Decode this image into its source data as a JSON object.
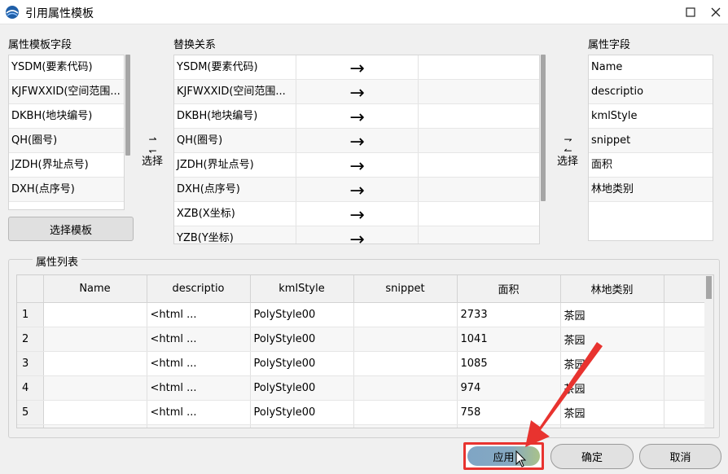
{
  "window": {
    "title": "引用属性模板",
    "maximize_icon": "maximize-icon",
    "close_icon": "close-icon"
  },
  "left_panel": {
    "label": "属性模板字段",
    "items": [
      "YSDM(要素代码)",
      "KJFWXXID(空间范围...",
      "DKBH(地块编号)",
      "QH(圈号)",
      "JZDH(界址点号)",
      "DXH(点序号)"
    ],
    "select_label": "选择",
    "template_button": "选择模板"
  },
  "mapping": {
    "label": "替换关系",
    "arrow": "→",
    "rows": [
      "YSDM(要素代码)",
      "KJFWXXID(空间范围...",
      "DKBH(地块编号)",
      "QH(圈号)",
      "JZDH(界址点号)",
      "DXH(点序号)",
      "XZB(X坐标)",
      "YZB(Y坐标)"
    ]
  },
  "right_panel": {
    "label": "属性字段",
    "items": [
      "Name",
      "descriptio",
      "kmlStyle",
      "snippet",
      "面积",
      "林地类别"
    ],
    "select_label": "选择"
  },
  "attribute_list": {
    "title": "属性列表",
    "columns": [
      "Name",
      "descriptio",
      "kmlStyle",
      "snippet",
      "面积",
      "林地类别"
    ],
    "rows": [
      {
        "num": "1",
        "name": "",
        "descriptio": "<html ...",
        "kmlStyle": "PolyStyle00",
        "snippet": "",
        "area": "2733",
        "type": "茶园"
      },
      {
        "num": "2",
        "name": "",
        "descriptio": "<html ...",
        "kmlStyle": "PolyStyle00",
        "snippet": "",
        "area": "1041",
        "type": "茶园"
      },
      {
        "num": "3",
        "name": "",
        "descriptio": "<html ...",
        "kmlStyle": "PolyStyle00",
        "snippet": "",
        "area": "1085",
        "type": "茶园"
      },
      {
        "num": "4",
        "name": "",
        "descriptio": "<html ...",
        "kmlStyle": "PolyStyle00",
        "snippet": "",
        "area": "974",
        "type": "茶园"
      },
      {
        "num": "5",
        "name": "",
        "descriptio": "<html ...",
        "kmlStyle": "PolyStyle00",
        "snippet": "",
        "area": "758",
        "type": "茶园"
      }
    ]
  },
  "footer": {
    "apply": "应用",
    "ok": "确定",
    "cancel": "取消"
  },
  "colors": {
    "highlight": "#e8332f",
    "apply_blue": "#7fa5c4",
    "apply_green": "#a9c28a"
  }
}
